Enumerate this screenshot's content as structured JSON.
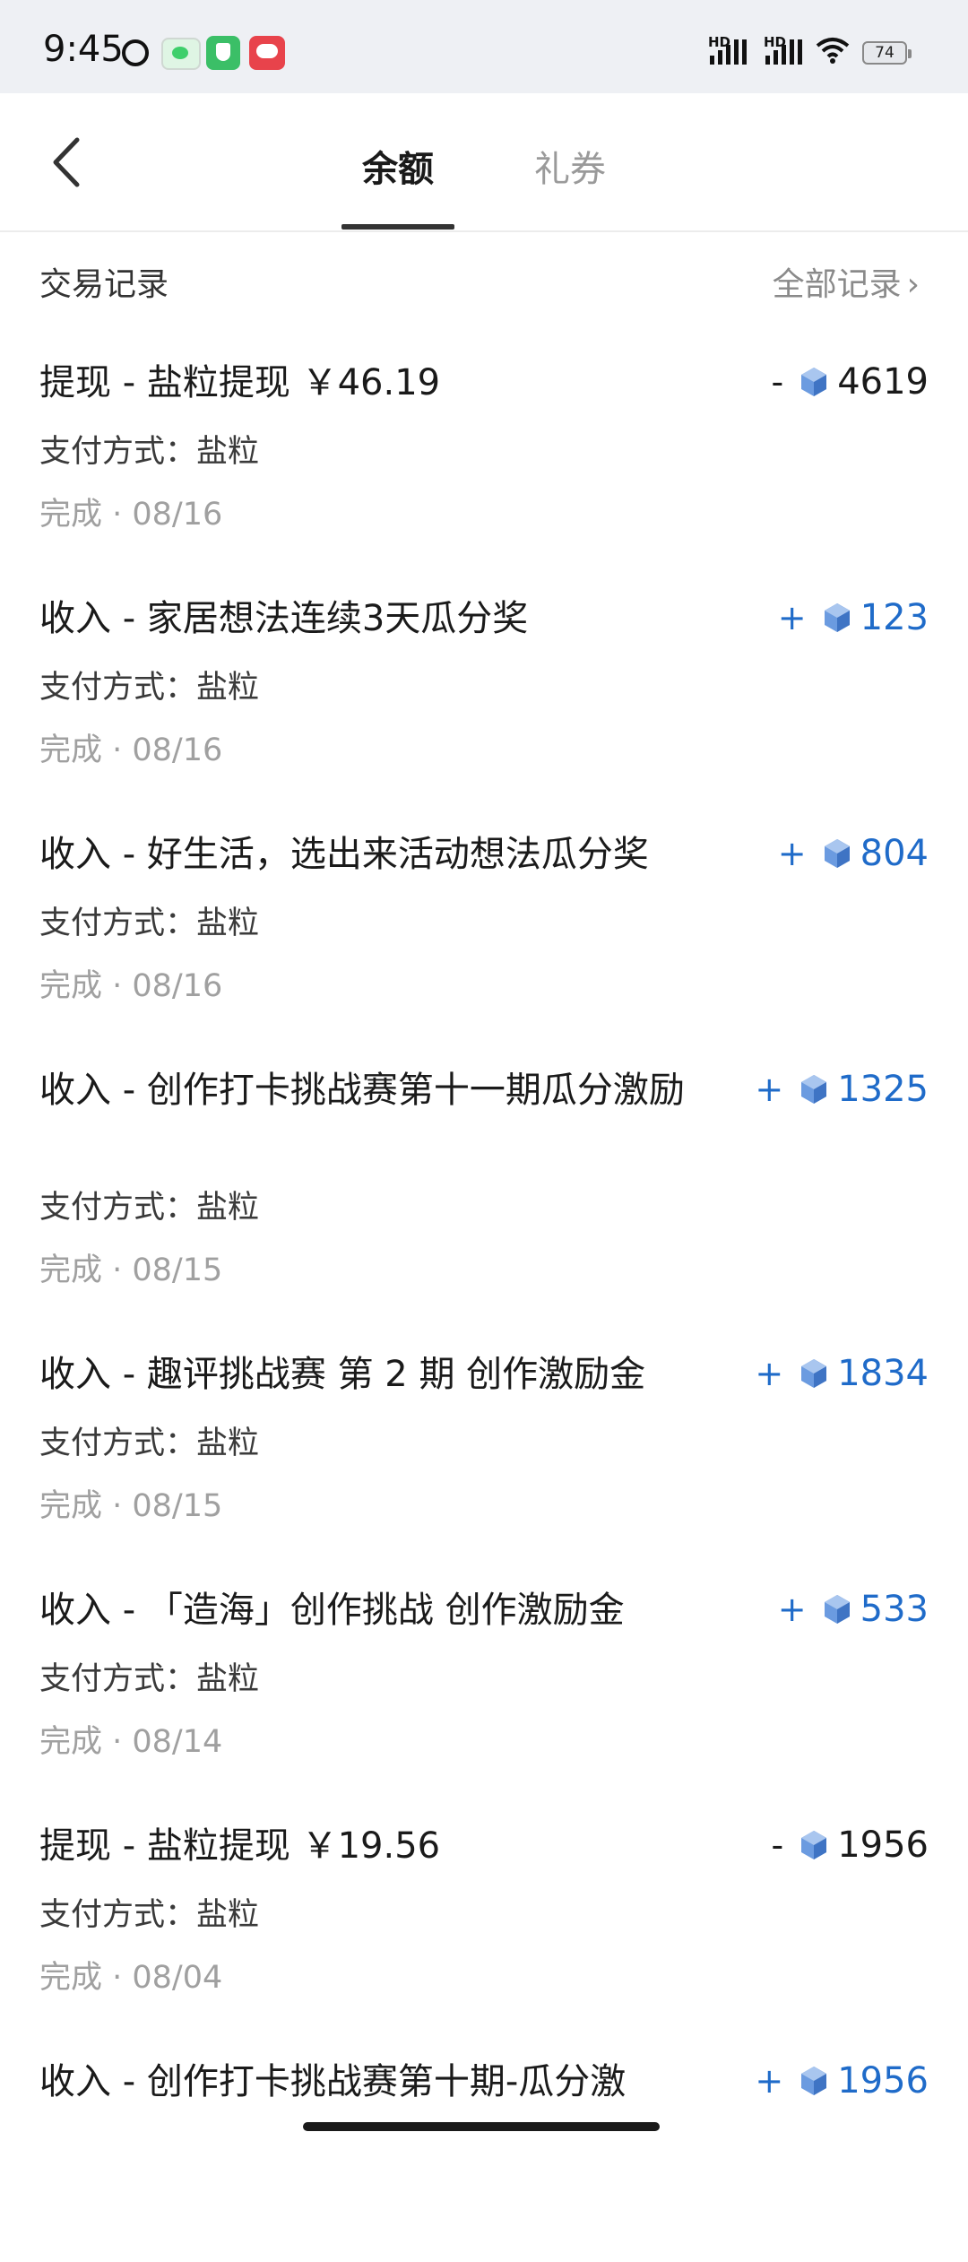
{
  "status_bar": {
    "time": "9:45",
    "battery": "74"
  },
  "header": {
    "tabs": [
      {
        "label": "余额",
        "active": true
      },
      {
        "label": "礼券",
        "active": false
      }
    ]
  },
  "section": {
    "title": "交易记录",
    "all_records_label": "全部记录"
  },
  "colors": {
    "positive": "#1f6bc9",
    "negative": "#1a1a1a",
    "coin": "#5b8fd6"
  },
  "records": [
    {
      "title": "提现 - 盐粒提现 ￥46.19",
      "payment": "支付方式：盐粒",
      "status": "完成 · 08/16",
      "sign": "-",
      "amount": "4619",
      "type": "negative"
    },
    {
      "title": "收入 - 家居想法连续3天瓜分奖",
      "payment": "支付方式：盐粒",
      "status": "完成 · 08/16",
      "sign": "+",
      "amount": "123",
      "type": "positive"
    },
    {
      "title": "收入 - 好生活，选出来活动想法瓜分奖",
      "payment": "支付方式：盐粒",
      "status": "完成 · 08/16",
      "sign": "+",
      "amount": "804",
      "type": "positive"
    },
    {
      "title": "收入 - 创作打卡挑战赛第十一期瓜分激励",
      "payment": "支付方式：盐粒",
      "status": "完成 · 08/15",
      "sign": "+",
      "amount": "1325",
      "type": "positive"
    },
    {
      "title": "收入 - 趣评挑战赛 第 2 期 创作激励金",
      "payment": "支付方式：盐粒",
      "status": "完成 · 08/15",
      "sign": "+",
      "amount": "1834",
      "type": "positive"
    },
    {
      "title": "收入 - 「造海」创作挑战 创作激励金",
      "payment": "支付方式：盐粒",
      "status": "完成 · 08/14",
      "sign": "+",
      "amount": "533",
      "type": "positive"
    },
    {
      "title": "提现 - 盐粒提现 ￥19.56",
      "payment": "支付方式：盐粒",
      "status": "完成 · 08/04",
      "sign": "-",
      "amount": "1956",
      "type": "negative"
    },
    {
      "title": "收入 - 创作打卡挑战赛第十期-瓜分激",
      "payment": "",
      "status": "",
      "sign": "+",
      "amount": "1956",
      "type": "positive"
    }
  ]
}
